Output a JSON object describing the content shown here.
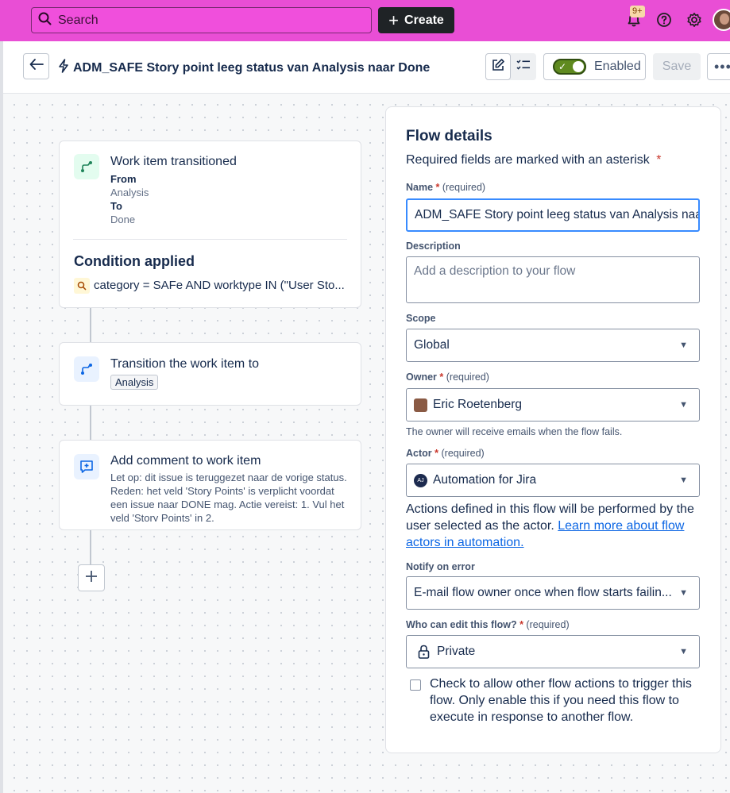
{
  "topbar": {
    "search_placeholder": "Search",
    "create_label": "Create",
    "notifications_badge": "9+",
    "icons": [
      "search-icon",
      "plus-icon",
      "bell-icon",
      "help-icon",
      "settings-icon"
    ]
  },
  "header": {
    "flow_title": "ADM_SAFE Story point leeg status van Analysis naar Done",
    "enabled_label": "Enabled",
    "enabled": true,
    "save_label": "Save"
  },
  "flow": {
    "trigger": {
      "title": "Work item transitioned",
      "from_label": "From",
      "from_value": "Analysis",
      "to_label": "To",
      "to_value": "Done"
    },
    "condition": {
      "heading": "Condition applied",
      "text": "category = SAFe AND worktype IN (\"User Sto..."
    },
    "action_transition": {
      "title": "Transition the work item to",
      "value": "Analysis"
    },
    "action_comment": {
      "title": "Add comment to work item",
      "text": "Let op: dit issue is teruggezet naar de vorige status. Reden: het veld 'Story Points' is verplicht voordat een issue naar DONE mag. Actie vereist: 1. Vul het veld 'Story Points' in 2."
    }
  },
  "details": {
    "heading": "Flow details",
    "required_note": "Required fields are marked with an asterisk",
    "asterisk": "*",
    "required_tag": "(required)",
    "name_label": "Name",
    "name_value": "ADM_SAFE Story point leeg status van Analysis naar Done",
    "description_label": "Description",
    "description_placeholder": "Add a description to your flow",
    "scope_label": "Scope",
    "scope_value": "Global",
    "owner_label": "Owner",
    "owner_value": "Eric Roetenberg",
    "owner_help": "The owner will receive emails when the flow fails.",
    "actor_label": "Actor",
    "actor_value": "Automation for Jira",
    "actor_avatar_text": "AJ",
    "actor_help": "Actions defined in this flow will be performed by the user selected as the actor.",
    "actor_link": "Learn more about flow actors in automation.",
    "notify_label": "Notify on error",
    "notify_value": "E-mail flow owner once when flow starts failin...",
    "edit_label": "Who can edit this flow?",
    "edit_value": "Private",
    "allow_trigger_text": "Check to allow other flow actions to trigger this flow. Only enable this if you need this flow to execute in response to another flow.",
    "allow_trigger_checked": false
  }
}
